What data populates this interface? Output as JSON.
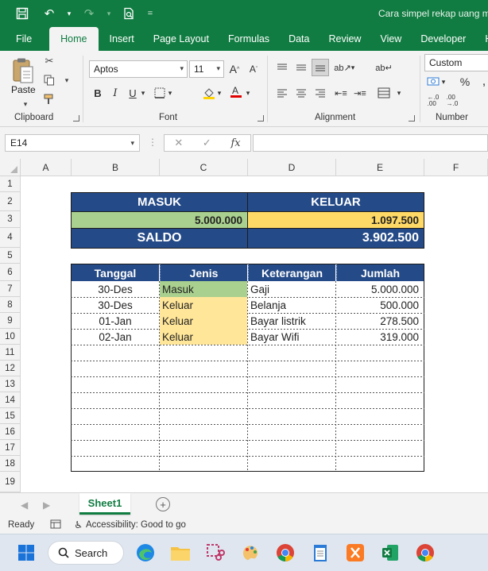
{
  "title_bar": {
    "doc_title": "Cara simpel rekap uang m",
    "menu_glyph": "="
  },
  "tabs": [
    "File",
    "Home",
    "Insert",
    "Page Layout",
    "Formulas",
    "Data",
    "Review",
    "View",
    "Developer",
    "H"
  ],
  "active_tab": "Home",
  "ribbon": {
    "clipboard": {
      "paste_label": "Paste",
      "group_label": "Clipboard"
    },
    "font": {
      "font_name": "Aptos",
      "font_size": "11",
      "group_label": "Font",
      "bold": "B",
      "italic": "I",
      "underline": "U",
      "grow": "A",
      "shrink": "A"
    },
    "alignment": {
      "group_label": "Alignment"
    },
    "number": {
      "format": "Custom",
      "group_label": "Number",
      "percent": "%"
    }
  },
  "formula_bar": {
    "name_box": "E14",
    "fx": "fx"
  },
  "columns": [
    "A",
    "B",
    "C",
    "D",
    "E",
    "F"
  ],
  "rows": [
    "1",
    "2",
    "3",
    "4",
    "5",
    "6",
    "7",
    "8",
    "9",
    "10",
    "11",
    "12",
    "13",
    "14",
    "15",
    "16",
    "17",
    "18",
    "19"
  ],
  "summary": {
    "masuk_label": "MASUK",
    "keluar_label": "KELUAR",
    "masuk_value": "5.000.000",
    "keluar_value": "1.097.500",
    "saldo_label": "SALDO",
    "saldo_value": "3.902.500"
  },
  "table": {
    "headers": [
      "Tanggal",
      "Jenis",
      "Keterangan",
      "Jumlah"
    ],
    "rows": [
      {
        "tanggal": "30-Des",
        "jenis": "Masuk",
        "keterangan": "Gaji",
        "jumlah": "5.000.000"
      },
      {
        "tanggal": "30-Des",
        "jenis": "Keluar",
        "keterangan": "Belanja",
        "jumlah": "500.000"
      },
      {
        "tanggal": "01-Jan",
        "jenis": "Keluar",
        "keterangan": "Bayar listrik",
        "jumlah": "278.500"
      },
      {
        "tanggal": "02-Jan",
        "jenis": "Keluar",
        "keterangan": "Bayar Wifi",
        "jumlah": "319.000"
      }
    ]
  },
  "sheet_tabs": {
    "active": "Sheet1"
  },
  "status_bar": {
    "ready": "Ready",
    "accessibility": "Accessibility: Good to go"
  },
  "taskbar": {
    "search_label": "Search"
  },
  "colors": {
    "excel_green": "#107c41",
    "header_blue": "#244a87",
    "masuk_green": "#a9d08e",
    "keluar_yellow": "#ffd966",
    "keluar_light": "#ffe699"
  }
}
